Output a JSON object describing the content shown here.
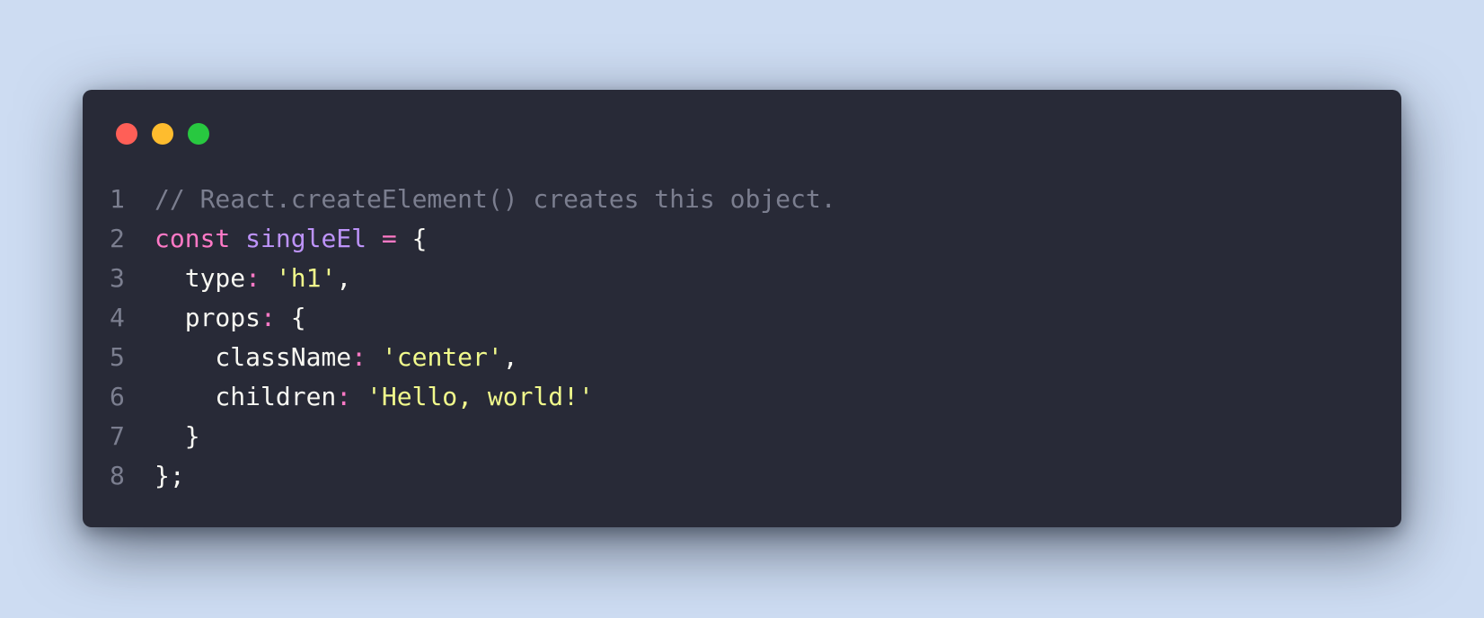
{
  "colors": {
    "page_background": "#cddcf2",
    "window_background": "#282a37",
    "close": "#ff5f57",
    "minimize": "#febc2e",
    "maximize": "#28c840",
    "comment": "#7b7e8f",
    "keyword": "#ff79c6",
    "variable": "#bd93f9",
    "string": "#f1fa8c",
    "text": "#f8f8f2"
  },
  "window_controls": {
    "close_icon": "red-dot-icon",
    "minimize_icon": "yellow-dot-icon",
    "maximize_icon": "green-dot-icon"
  },
  "code": {
    "lines": [
      {
        "number": "1",
        "tokens": [
          {
            "type": "comment",
            "text": "// React.createElement() creates this object."
          }
        ]
      },
      {
        "number": "2",
        "tokens": [
          {
            "type": "keyword",
            "text": "const"
          },
          {
            "type": "punc",
            "text": " "
          },
          {
            "type": "var",
            "text": "singleEl"
          },
          {
            "type": "punc",
            "text": " "
          },
          {
            "type": "op",
            "text": "="
          },
          {
            "type": "punc",
            "text": " {"
          }
        ]
      },
      {
        "number": "3",
        "tokens": [
          {
            "type": "prop",
            "text": "  type"
          },
          {
            "type": "op",
            "text": ":"
          },
          {
            "type": "punc",
            "text": " "
          },
          {
            "type": "str",
            "text": "'h1'"
          },
          {
            "type": "punc",
            "text": ","
          }
        ]
      },
      {
        "number": "4",
        "tokens": [
          {
            "type": "prop",
            "text": "  props"
          },
          {
            "type": "op",
            "text": ":"
          },
          {
            "type": "punc",
            "text": " {"
          }
        ]
      },
      {
        "number": "5",
        "tokens": [
          {
            "type": "prop",
            "text": "    className"
          },
          {
            "type": "op",
            "text": ":"
          },
          {
            "type": "punc",
            "text": " "
          },
          {
            "type": "str",
            "text": "'center'"
          },
          {
            "type": "punc",
            "text": ","
          }
        ]
      },
      {
        "number": "6",
        "tokens": [
          {
            "type": "prop",
            "text": "    children"
          },
          {
            "type": "op",
            "text": ":"
          },
          {
            "type": "punc",
            "text": " "
          },
          {
            "type": "str",
            "text": "'Hello, world!'"
          }
        ]
      },
      {
        "number": "7",
        "tokens": [
          {
            "type": "punc",
            "text": "  }"
          }
        ]
      },
      {
        "number": "8",
        "tokens": [
          {
            "type": "punc",
            "text": "};"
          }
        ]
      }
    ]
  }
}
